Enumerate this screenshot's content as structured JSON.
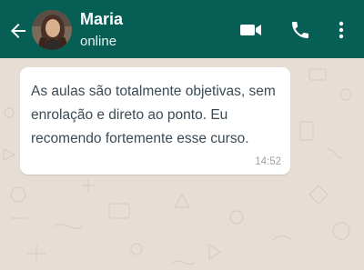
{
  "header": {
    "contact_name": "Maria",
    "status": "online",
    "icons": {
      "back": "arrow-left-icon",
      "video": "video-call-icon",
      "phone": "phone-icon",
      "more": "more-vertical-icon"
    }
  },
  "chat": {
    "messages": [
      {
        "text": "As aulas são totalmente objetivas, sem enrolação e direto ao ponto. Eu recomendo fortemente esse curso.",
        "time": "14:52"
      }
    ]
  },
  "colors": {
    "header_bg": "#075e54",
    "chat_bg": "#e6ddd4",
    "bubble_bg": "#ffffff"
  }
}
